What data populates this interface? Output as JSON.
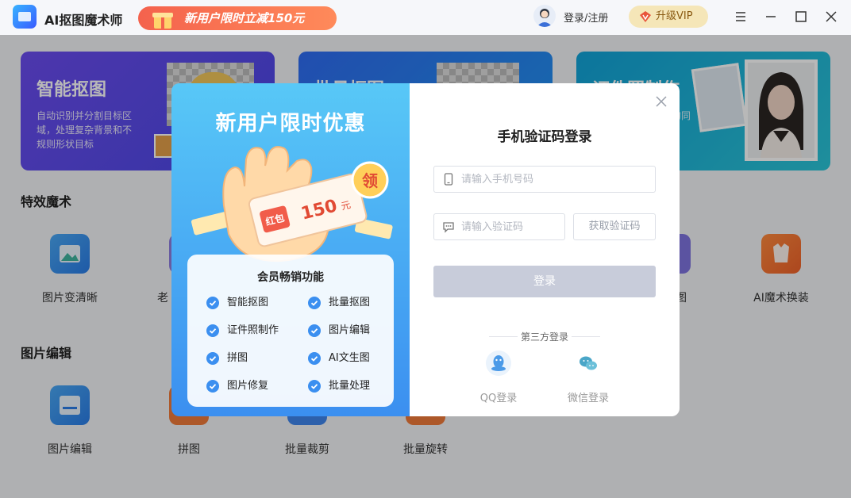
{
  "titlebar": {
    "app_name": "AI抠图魔术师",
    "promo_text": "新用户限时立减150元",
    "login_label": "登录/注册",
    "vip_label": "升级VIP"
  },
  "cards": [
    {
      "title": "智能抠图",
      "desc": "自动识别并分割目标区域，处理复杂背景和不规则形状目标"
    },
    {
      "title": "批量抠图",
      "desc": ""
    },
    {
      "title": "证件照制作",
      "desc": "的同"
    }
  ],
  "sections": {
    "effects_title": "特效魔术",
    "edit_title": "图片编辑"
  },
  "effects_tools": [
    {
      "label": "图片变清晰"
    },
    {
      "label": "老"
    },
    {
      "label": "图"
    },
    {
      "label": "AI魔术换装"
    }
  ],
  "edit_tools": [
    {
      "label": "图片编辑"
    },
    {
      "label": "拼图"
    },
    {
      "label": "批量裁剪"
    },
    {
      "label": "批量旋转"
    }
  ],
  "promo_modal": {
    "title": "新用户限时优惠",
    "coupon_label": "红包",
    "coupon_amount": "150",
    "coupon_unit": "元",
    "claim_label": "领",
    "benefits_title": "会员畅销功能",
    "benefits": [
      "智能抠图",
      "批量抠图",
      "证件照制作",
      "图片编辑",
      "拼图",
      "AI文生图",
      "图片修复",
      "批量处理"
    ]
  },
  "login_modal": {
    "title": "手机验证码登录",
    "phone_placeholder": "请输入手机号码",
    "code_placeholder": "请输入验证码",
    "get_code_label": "获取验证码",
    "submit_label": "登录",
    "third_party_label": "第三方登录",
    "qq_label": "QQ登录",
    "wechat_label": "微信登录"
  },
  "colors": {
    "accent_blue": "#3b8ff0",
    "vip_gold": "#f5e6b8",
    "promo_red": "#f4624d",
    "disabled_button": "#c8ccda"
  }
}
